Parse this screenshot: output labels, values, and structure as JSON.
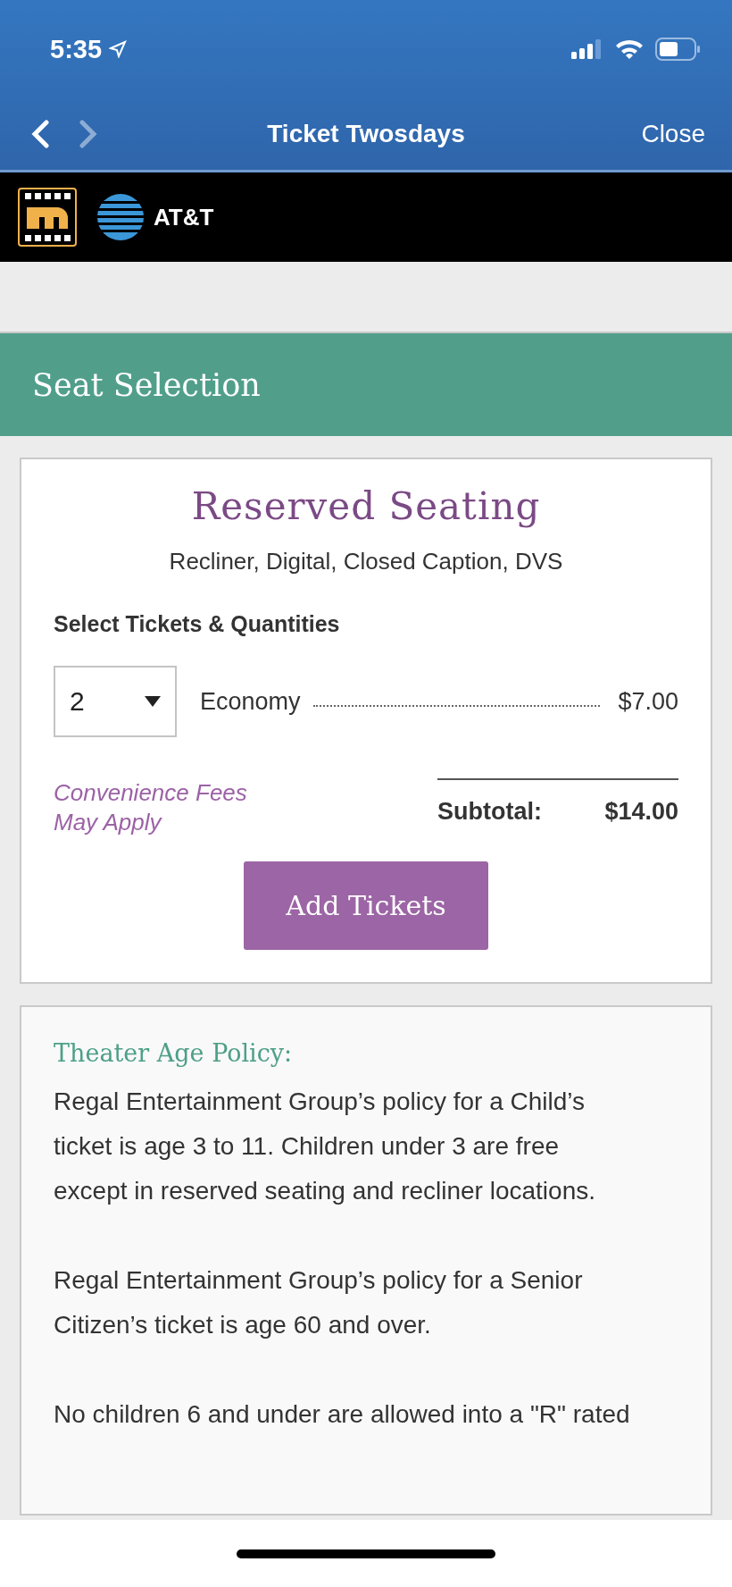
{
  "status_bar": {
    "time": "5:35"
  },
  "nav": {
    "title": "Ticket Twosdays",
    "close": "Close",
    "back_enabled": true,
    "forward_enabled": false
  },
  "brand_bar": {
    "partner": "AT&T"
  },
  "section_header": "Seat Selection",
  "reservation": {
    "title": "Reserved Seating",
    "features": "Recliner, Digital, Closed Caption, DVS",
    "prompt": "Select Tickets & Quantities",
    "tickets": [
      {
        "quantity": "2",
        "type": "Economy",
        "price": "$7.00"
      }
    ],
    "fees_note": "Convenience Fees\nMay Apply",
    "subtotal_label": "Subtotal:",
    "subtotal": "$14.00",
    "button": "Add Tickets"
  },
  "policy": {
    "title": "Theater Age Policy:",
    "paragraphs": [
      "Regal Entertainment Group’s policy for a Child’s ticket is age 3 to 11. Children under 3 are free except in reserved seating and recliner locations.",
      "Regal Entertainment Group’s policy for a Senior Citizen’s ticket is age 60 and over.",
      "No children 6 and under are allowed into a \"R\" rated"
    ]
  }
}
